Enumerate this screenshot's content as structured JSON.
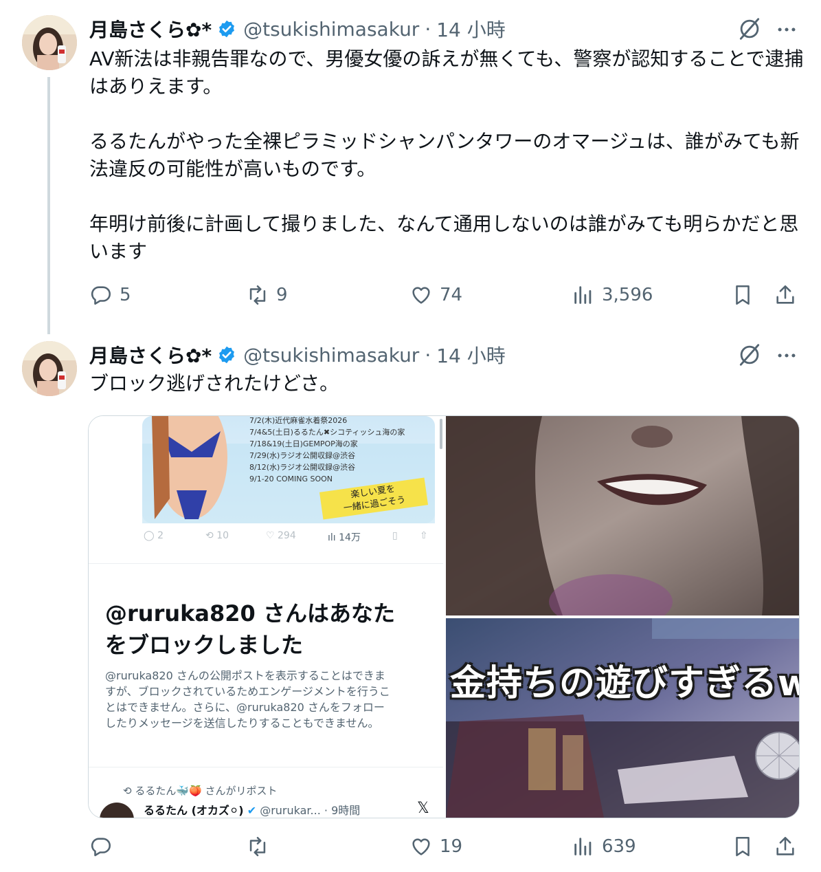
{
  "tweets": [
    {
      "display_name": "月島さくら✿*",
      "handle": "@tsukishimasakur",
      "separator": "·",
      "time": "14 小時",
      "text": "AV新法は非親告罪なので、男優女優の訴えが無くても、警察が認知することで逮捕はありえます。\n\nるるたんがやった全裸ピラミッドシャンパンタワーのオマージュは、誰がみても新法違反の可能性が高いものです。\n\n年明け前後に計画して撮りました、なんて通用しないのは誰がみても明らかだと思います",
      "replies": "5",
      "reposts": "9",
      "likes": "74",
      "views": "3,596"
    },
    {
      "display_name": "月島さくら✿*",
      "handle": "@tsukishimasakur",
      "separator": "·",
      "time": "14 小時",
      "text": "ブロック逃げされたけどさ。",
      "replies": "",
      "reposts": "",
      "likes": "19",
      "views": "639"
    }
  ],
  "media": {
    "screenshot": {
      "schedule_lines": [
        "7/2(木)近代麻雀水着祭2026",
        "7/4&5(土日)るるたん✖シコティッシュ海の家",
        "7/18&19(土日)GEMPOP海の家",
        "7/29(水)ラジオ公開収録@渋谷",
        "8/12(水)ラジオ公開収録@渋谷",
        "9/1-20 COMING SOON"
      ],
      "sticker_line1": "楽しい夏を",
      "sticker_line2": "一緒に過ごそう",
      "embedded_replies": "2",
      "embedded_reposts": "10",
      "embedded_likes": "294",
      "embedded_views": "14万",
      "block_title_line1": "@ruruka820 さんはあなた",
      "block_title_line2": "をブロックしました",
      "block_body_lines": [
        "@ruruka820 さんの公開ポストを表示することはできま",
        "すが、ブロックされているためエンゲージメントを行うこ",
        "とはできません。さらに、@ruruka820 さんをフォロー",
        "したりメッセージを送信したりすることもできません。"
      ],
      "repost_line": "るるたん🐳🍑 さんがリポスト",
      "embedded_author": "るるたん (オカズ⚪)",
      "embedded_handle": "@rurukar...",
      "embedded_time": "· 9時間"
    },
    "video_caption": "金持ちの遊びすぎるw"
  },
  "colors": {
    "text": "#0f1419",
    "secondary": "#536471",
    "verified": "#1d9bf0",
    "border": "#cfd9de"
  }
}
